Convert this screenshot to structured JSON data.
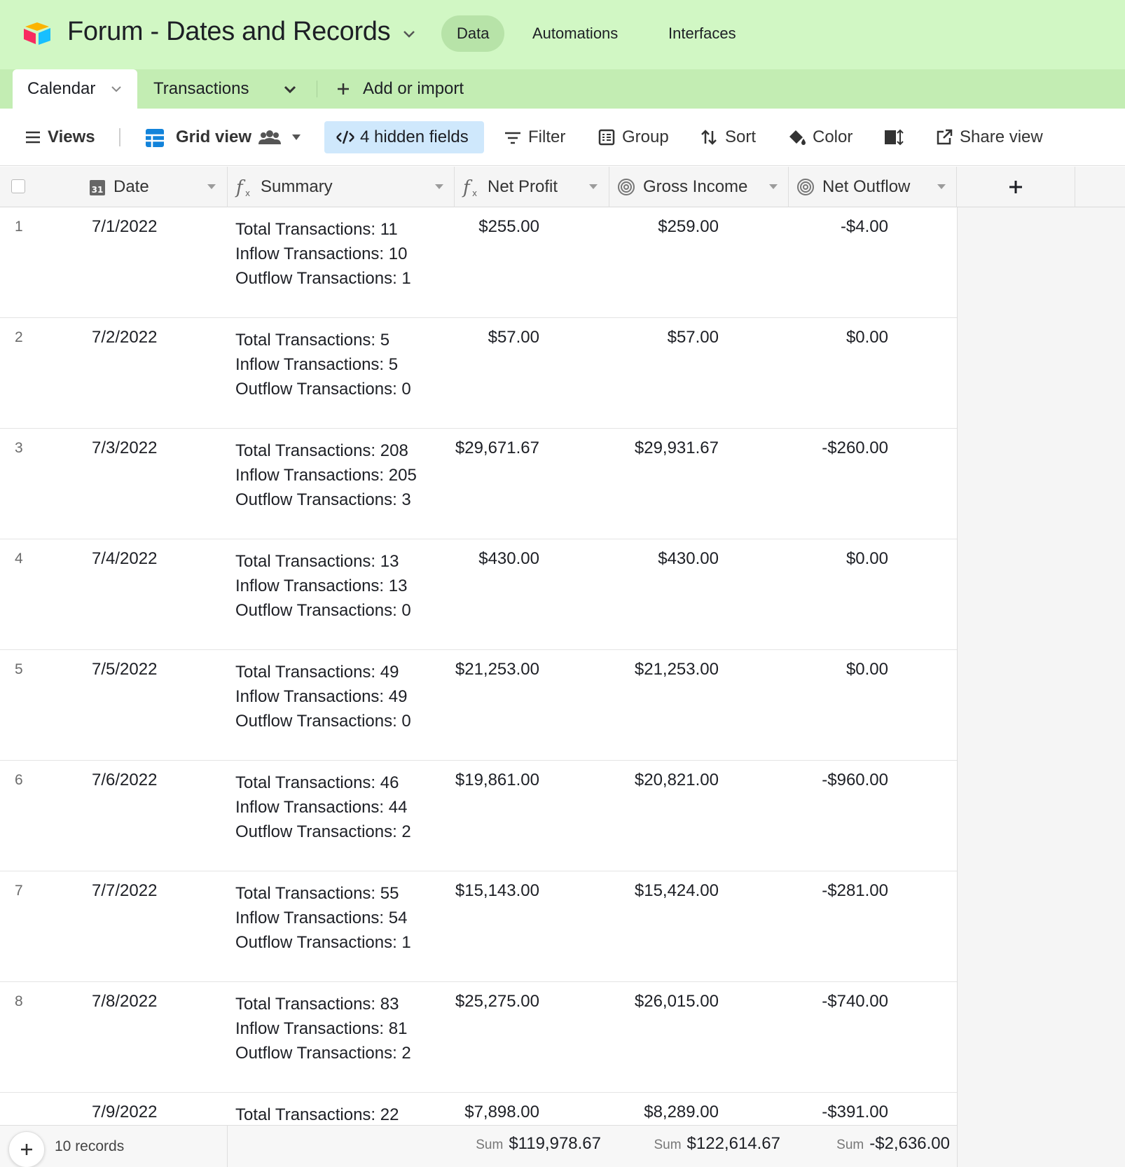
{
  "app": {
    "title": "Forum - Dates and Records",
    "nav": [
      "Data",
      "Automations",
      "Interfaces"
    ]
  },
  "tabs": {
    "active": "Calendar",
    "other": "Transactions",
    "add": "Add or import"
  },
  "toolbar": {
    "views": "Views",
    "grid_view": "Grid view",
    "hidden_fields": "4 hidden fields",
    "filter": "Filter",
    "group": "Group",
    "sort": "Sort",
    "color": "Color",
    "share": "Share view"
  },
  "columns": {
    "date": "Date",
    "summary": "Summary",
    "net_profit": "Net Profit",
    "gross_income": "Gross Income",
    "net_outflow": "Net Outflow"
  },
  "rows": [
    {
      "n": "1",
      "date": "7/1/2022",
      "s1": "Total Transactions: 11",
      "s2": "Inflow Transactions: 10",
      "s3": "Outflow Transactions: 1",
      "np": "$255.00",
      "gi": "$259.00",
      "no": "-$4.00"
    },
    {
      "n": "2",
      "date": "7/2/2022",
      "s1": "Total Transactions: 5",
      "s2": "Inflow Transactions: 5",
      "s3": "Outflow Transactions: 0",
      "np": "$57.00",
      "gi": "$57.00",
      "no": "$0.00"
    },
    {
      "n": "3",
      "date": "7/3/2022",
      "s1": "Total Transactions: 208",
      "s2": "Inflow Transactions: 205",
      "s3": "Outflow Transactions: 3",
      "np": "$29,671.67",
      "gi": "$29,931.67",
      "no": "-$260.00"
    },
    {
      "n": "4",
      "date": "7/4/2022",
      "s1": "Total Transactions: 13",
      "s2": "Inflow Transactions: 13",
      "s3": "Outflow Transactions: 0",
      "np": "$430.00",
      "gi": "$430.00",
      "no": "$0.00"
    },
    {
      "n": "5",
      "date": "7/5/2022",
      "s1": "Total Transactions: 49",
      "s2": "Inflow Transactions: 49",
      "s3": "Outflow Transactions: 0",
      "np": "$21,253.00",
      "gi": "$21,253.00",
      "no": "$0.00"
    },
    {
      "n": "6",
      "date": "7/6/2022",
      "s1": "Total Transactions: 46",
      "s2": "Inflow Transactions: 44",
      "s3": "Outflow Transactions: 2",
      "np": "$19,861.00",
      "gi": "$20,821.00",
      "no": "-$960.00"
    },
    {
      "n": "7",
      "date": "7/7/2022",
      "s1": "Total Transactions: 55",
      "s2": "Inflow Transactions: 54",
      "s3": "Outflow Transactions: 1",
      "np": "$15,143.00",
      "gi": "$15,424.00",
      "no": "-$281.00"
    },
    {
      "n": "8",
      "date": "7/8/2022",
      "s1": "Total Transactions: 83",
      "s2": "Inflow Transactions: 81",
      "s3": "Outflow Transactions: 2",
      "np": "$25,275.00",
      "gi": "$26,015.00",
      "no": "-$740.00"
    },
    {
      "n": "",
      "date": "7/9/2022",
      "s1": "Total Transactions: 22",
      "s2": "",
      "s3": "",
      "np": "$7,898.00",
      "gi": "$8,289.00",
      "no": "-$391.00"
    }
  ],
  "footer": {
    "records": "10 records",
    "sum_label": "Sum",
    "np_sum": "$119,978.67",
    "gi_sum": "$122,614.67",
    "no_sum": "-$2,636.00"
  },
  "colors": {
    "topbar": "#d1f7c4",
    "tabbar": "#c3edb3",
    "hidden_fields_bg": "#cfe8fc",
    "grid_icon": "#1283da"
  }
}
